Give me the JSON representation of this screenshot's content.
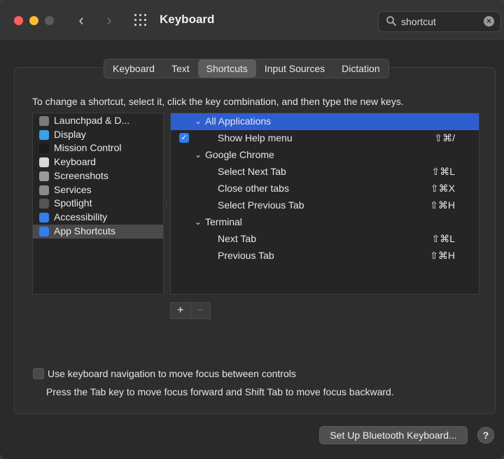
{
  "window": {
    "title": "Keyboard"
  },
  "search": {
    "value": "shortcut"
  },
  "tabs": [
    {
      "label": "Keyboard"
    },
    {
      "label": "Text"
    },
    {
      "label": "Shortcuts",
      "active": true
    },
    {
      "label": "Input Sources"
    },
    {
      "label": "Dictation"
    }
  ],
  "instruction": "To change a shortcut, select it, click the key combination, and then type the new keys.",
  "sidebar": {
    "items": [
      {
        "label": "Launchpad & D...",
        "icon": "launchpad-icon",
        "color": "#7a7a7a"
      },
      {
        "label": "Display",
        "icon": "display-icon",
        "color": "#3aa0e8"
      },
      {
        "label": "Mission Control",
        "icon": "mission-control-icon",
        "color": "#1b1b1b"
      },
      {
        "label": "Keyboard",
        "icon": "keyboard-icon",
        "color": "#d8d8d8"
      },
      {
        "label": "Screenshots",
        "icon": "screenshots-icon",
        "color": "#9a9a9a"
      },
      {
        "label": "Services",
        "icon": "services-icon",
        "color": "#8a8a8a"
      },
      {
        "label": "Spotlight",
        "icon": "spotlight-icon",
        "color": "#555555"
      },
      {
        "label": "Accessibility",
        "icon": "accessibility-icon",
        "color": "#2f7ff0"
      },
      {
        "label": "App Shortcuts",
        "icon": "app-shortcuts-icon",
        "color": "#2f7ff0",
        "selected": true
      }
    ]
  },
  "shortcuts": {
    "rows": [
      {
        "type": "group",
        "label": "All Applications",
        "selected": true
      },
      {
        "type": "item",
        "label": "Show Help menu",
        "keys": "⇧⌘/",
        "checked": true
      },
      {
        "type": "group",
        "label": "Google Chrome"
      },
      {
        "type": "item",
        "label": "Select Next Tab",
        "keys": "⇧⌘L"
      },
      {
        "type": "item",
        "label": "Close other tabs",
        "keys": "⇧⌘X"
      },
      {
        "type": "item",
        "label": "Select Previous Tab",
        "keys": "⇧⌘H"
      },
      {
        "type": "group",
        "label": "Terminal"
      },
      {
        "type": "item",
        "label": "Next Tab",
        "keys": "⇧⌘L"
      },
      {
        "type": "item",
        "label": "Previous Tab",
        "keys": "⇧⌘H"
      }
    ]
  },
  "controls": {
    "add": "+",
    "remove": "−"
  },
  "keyboard_navigation": {
    "label": "Use keyboard navigation to move focus between controls",
    "checked": false,
    "help": "Press the Tab key to move focus forward and Shift Tab to move focus backward."
  },
  "bluetooth_button": "Set Up Bluetooth Keyboard...",
  "help_button": "?",
  "colors": {
    "accent": "#2f7ff0",
    "selection": "#2e5fd0"
  }
}
